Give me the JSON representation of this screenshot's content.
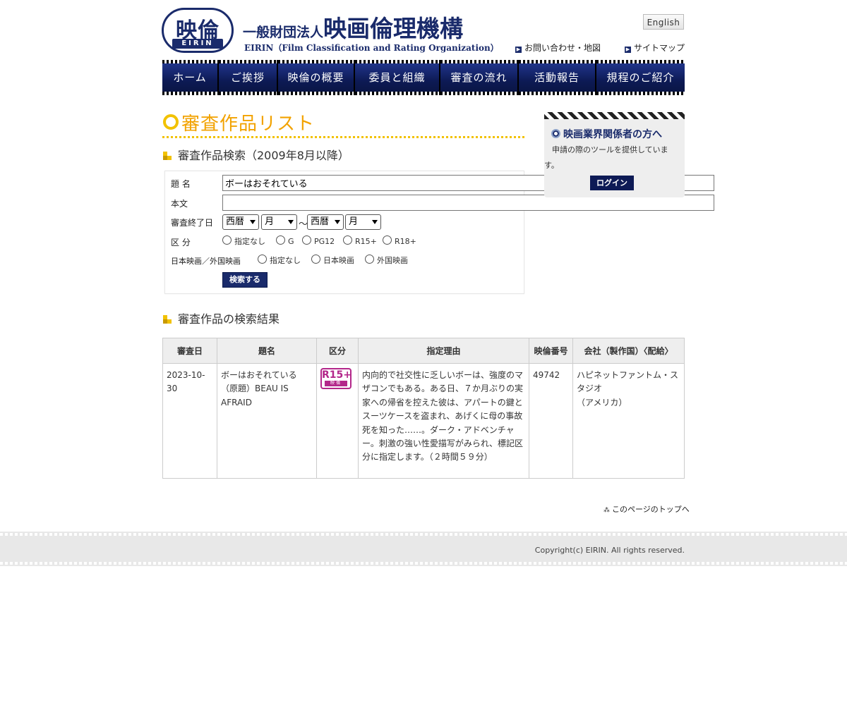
{
  "header": {
    "logo_kanji": "映倫",
    "logo_band": "EIRIN",
    "org_small": "一般財団法人",
    "org_name": "映画倫理機構",
    "org_sub": "EIRIN（Film Classification and Rating Organization）",
    "lang_button": "English",
    "contact_link": "お問い合わせ・地図",
    "sitemap_link": "サイトマップ"
  },
  "nav": [
    "ホーム",
    "ご挨拶",
    "映倫の概要",
    "委員と組織",
    "審査の流れ",
    "活動報告",
    "規程のご紹介"
  ],
  "main": {
    "page_title": "審査作品リスト",
    "search_heading": "審査作品検索（2009年8月以降）",
    "results_heading": "審査作品の検索結果"
  },
  "search": {
    "title_label": "題 名",
    "title_value": "ボーはおそれている",
    "body_label": "本文",
    "body_value": "",
    "date_label": "審査終了日",
    "era_1": "西暦",
    "month_1": "月",
    "tilde": "～",
    "era_2": "西暦",
    "month_2": "月",
    "class_label": "区 分",
    "class_options": [
      "指定なし",
      "G",
      "PG12",
      "R15+",
      "R18+"
    ],
    "origin_label": "日本映画／外国映画",
    "origin_options": [
      "指定なし",
      "日本映画",
      "外国映画"
    ],
    "submit": "検索する"
  },
  "sidebar": {
    "heading": "映画業界関係者の方へ",
    "description": "申請の際のツールを提供しています。",
    "login": "ログイン"
  },
  "table": {
    "headers": [
      "審査日",
      "題名",
      "区分",
      "指定理由",
      "映倫番号",
      "会社（製作国）〈配給〉"
    ],
    "rows": [
      {
        "date": "2023-10-30",
        "title": "ボーはおそれている（原題）BEAU IS AFRAID",
        "rating_mark": "R15+",
        "rating_sub": "映倫",
        "reason": "内向的で社交性に乏しいボーは、強度のマザコンでもある。ある日、７か月ぶりの実家への帰省を控えた彼は、アパートの鍵とスーツケースを盗まれ、あげくに母の事故死を知った……。ダーク・アドベンチャー。刺激の強い性愛描写がみられ、標記区分に指定します。（２時間５９分）",
        "number": "49742",
        "company": "ハピネットファントム・スタジオ",
        "country": "（アメリカ）"
      }
    ]
  },
  "page_top": "このページのトップへ",
  "footer": {
    "copyright": "Copyright(c) EIRIN. All rights reserved."
  },
  "colors": {
    "brand_navy": "#1a2b6b",
    "title_gold": "#f2a200",
    "rating_magenta": "#b3278a"
  }
}
